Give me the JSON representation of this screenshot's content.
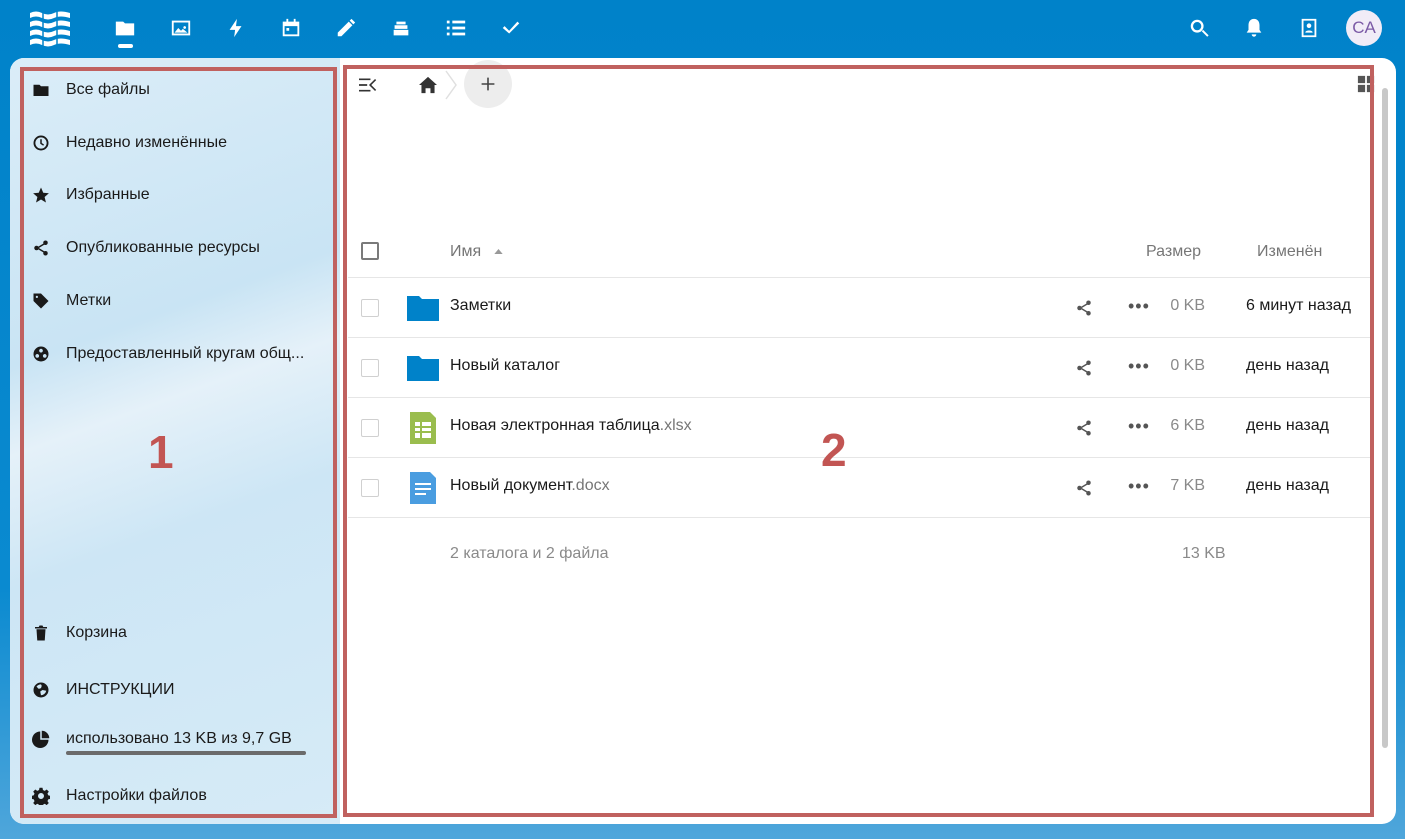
{
  "header": {
    "apps": [
      {
        "name": "files-icon",
        "active": true
      },
      {
        "name": "photos-icon"
      },
      {
        "name": "activity-icon"
      },
      {
        "name": "calendar-icon"
      },
      {
        "name": "notes-icon"
      },
      {
        "name": "deck-icon"
      },
      {
        "name": "list-icon"
      },
      {
        "name": "tasks-icon"
      }
    ],
    "avatar_initials": "CA"
  },
  "sidebar": {
    "items": [
      {
        "label": "Все файлы",
        "icon": "folder-icon"
      },
      {
        "label": "Недавно изменённые",
        "icon": "clock-icon"
      },
      {
        "label": "Избранные",
        "icon": "star-icon"
      },
      {
        "label": "Опубликованные ресурсы",
        "icon": "share-icon"
      },
      {
        "label": "Метки",
        "icon": "tag-icon"
      },
      {
        "label": "Предоставленный кругам общ...",
        "icon": "circles-icon"
      }
    ],
    "bottom_items": [
      {
        "label": "Корзина",
        "icon": "trash-icon"
      },
      {
        "label": "ИНСТРУКЦИИ",
        "icon": "globe-icon"
      },
      {
        "label": "использовано 13 KB из 9,7 GB",
        "icon": "pie-chart-icon"
      },
      {
        "label": "Настройки файлов",
        "icon": "gear-icon"
      }
    ],
    "quota_fraction": 0.999
  },
  "annotations": {
    "sidebar_number": "1",
    "main_number": "2"
  },
  "table": {
    "headers": {
      "name": "Имя",
      "size": "Размер",
      "modified": "Изменён"
    },
    "rows": [
      {
        "name": "Заметки",
        "ext": "",
        "type": "folder",
        "size": "0 KB",
        "modified": "6 минут назад"
      },
      {
        "name": "Новый каталог",
        "ext": "",
        "type": "folder",
        "size": "0 KB",
        "modified": "день назад"
      },
      {
        "name": "Новая электронная таблица",
        "ext": ".xlsx",
        "type": "spreadsheet",
        "size": "6 KB",
        "modified": "день назад"
      },
      {
        "name": "Новый документ",
        "ext": ".docx",
        "type": "document",
        "size": "7 KB",
        "modified": "день назад"
      }
    ],
    "summary": "2 каталога и 2 файла",
    "summary_size": "13 KB"
  },
  "colors": {
    "header_bg": "#0082c9",
    "folder": "#0082c9",
    "spreadsheet": "#9abd4e",
    "document": "#4a9de0",
    "annotation": "#c0615f"
  }
}
